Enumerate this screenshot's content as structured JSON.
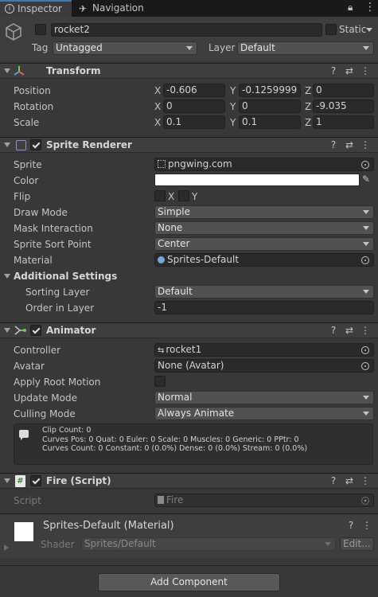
{
  "tabs": [
    {
      "label": "Inspector",
      "icon": "info-icon"
    },
    {
      "label": "Navigation",
      "icon": "navigation-icon"
    }
  ],
  "gameobject": {
    "name": "rocket2",
    "static_label": "Static",
    "tag_label": "Tag",
    "tag_value": "Untagged",
    "layer_label": "Layer",
    "layer_value": "Default"
  },
  "transform": {
    "title": "Transform",
    "rows": [
      {
        "label": "Position",
        "x": "-0.606",
        "y": "-0.1259999",
        "z": "0"
      },
      {
        "label": "Rotation",
        "x": "0",
        "y": "0",
        "z": "-9.035"
      },
      {
        "label": "Scale",
        "x": "0.1",
        "y": "0.1",
        "z": "1"
      }
    ]
  },
  "axes": {
    "x": "X",
    "y": "Y",
    "z": "Z"
  },
  "sprite_renderer": {
    "title": "Sprite Renderer",
    "sprite_label": "Sprite",
    "sprite_value": "pngwing.com",
    "color_label": "Color",
    "color_value": "#ffffff",
    "flip_label": "Flip",
    "flip_x": "X",
    "flip_y": "Y",
    "draw_mode_label": "Draw Mode",
    "draw_mode_value": "Simple",
    "mask_label": "Mask Interaction",
    "mask_value": "None",
    "sort_point_label": "Sprite Sort Point",
    "sort_point_value": "Center",
    "material_label": "Material",
    "material_value": "Sprites-Default",
    "additional_label": "Additional Settings",
    "sorting_layer_label": "Sorting Layer",
    "sorting_layer_value": "Default",
    "order_label": "Order in Layer",
    "order_value": "-1"
  },
  "animator": {
    "title": "Animator",
    "controller_label": "Controller",
    "controller_value": "rocket1",
    "avatar_label": "Avatar",
    "avatar_value": "None (Avatar)",
    "root_motion_label": "Apply Root Motion",
    "update_mode_label": "Update Mode",
    "update_mode_value": "Normal",
    "culling_label": "Culling Mode",
    "culling_value": "Always Animate",
    "info_line1": "Clip Count: 0",
    "info_line2": "Curves Pos: 0 Quat: 0 Euler: 0 Scale: 0 Muscles: 0 Generic: 0 PPtr: 0",
    "info_line3": "Curves Count: 0 Constant: 0 (0.0%) Dense: 0 (0.0%) Stream: 0 (0.0%)"
  },
  "fire_script": {
    "title": "Fire (Script)",
    "script_label": "Script",
    "script_value": "Fire"
  },
  "material": {
    "title": "Sprites-Default (Material)",
    "shader_label": "Shader",
    "shader_value": "Sprites/Default",
    "edit_label": "Edit..."
  },
  "add_component_label": "Add Component",
  "colors": {
    "accent": "#3a79bb",
    "panel": "#383838",
    "header": "#3e3e3e",
    "field": "#2a2a2a"
  }
}
